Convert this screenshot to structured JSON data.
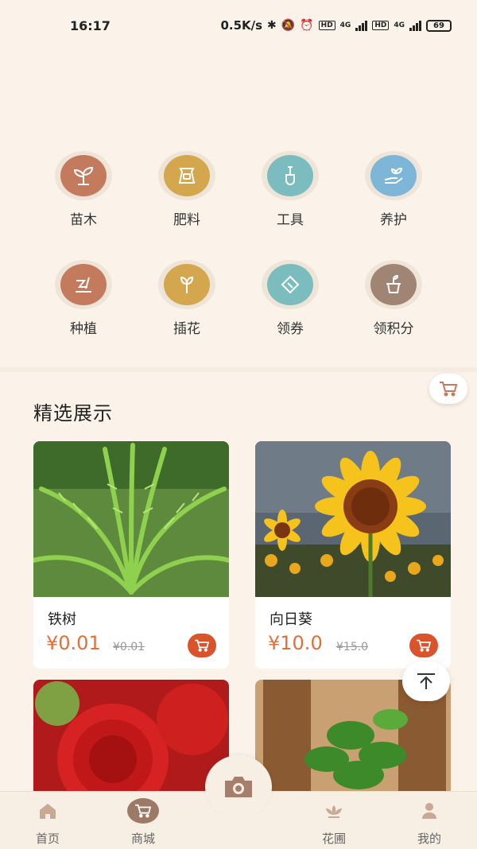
{
  "status_bar": {
    "time": "16:17",
    "net_speed": "0.5K/s",
    "hd1": "HD",
    "net1": "4G",
    "hd2": "HD",
    "net2": "4G",
    "battery": "69"
  },
  "categories": [
    {
      "label": "苗木",
      "icon": "seedling-icon",
      "color": "#c47a5d"
    },
    {
      "label": "肥料",
      "icon": "fertilizer-bag-icon",
      "color": "#d4a64e"
    },
    {
      "label": "工具",
      "icon": "shovel-icon",
      "color": "#7bbcbf"
    },
    {
      "label": "养护",
      "icon": "hand-plant-icon",
      "color": "#7eb6d8"
    },
    {
      "label": "种植",
      "icon": "planting-icon",
      "color": "#c47a5d"
    },
    {
      "label": "插花",
      "icon": "flower-bud-icon",
      "color": "#d4a64e"
    },
    {
      "label": "领券",
      "icon": "coupon-icon",
      "color": "#7bbcbf"
    },
    {
      "label": "领积分",
      "icon": "pot-icon",
      "color": "#a08574"
    }
  ],
  "section_title": "精选展示",
  "products": [
    {
      "name": "铁树",
      "price": "¥0.01",
      "old_price": "¥0.01"
    },
    {
      "name": "向日葵",
      "price": "¥10.0",
      "old_price": "¥15.0"
    }
  ],
  "tab_bar": {
    "home": "首页",
    "mall": "商城",
    "garden": "花圃",
    "mine": "我的"
  },
  "colors": {
    "accent": "#e0703a",
    "cart_button": "#d9542a",
    "background": "#fbf3ea"
  }
}
